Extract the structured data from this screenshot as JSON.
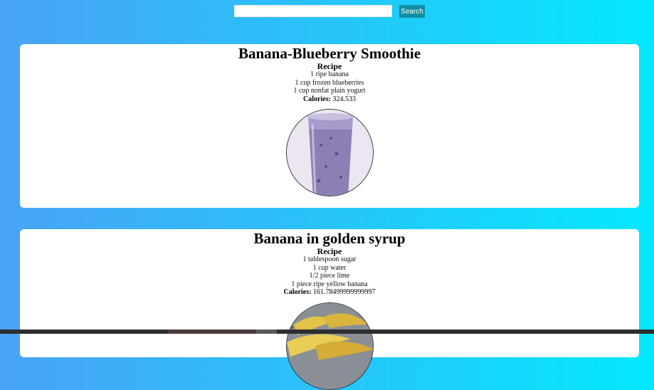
{
  "search": {
    "placeholder": "",
    "value": "",
    "button_label": "Search"
  },
  "recipes": [
    {
      "title": "Banana-Blueberry Smoothie",
      "recipe_label": "Recipe",
      "ingredients": [
        "1 ripe banana",
        "1 cup frozen blueberries",
        "1 cup nonfat plain yogurt"
      ],
      "calories_label": "Calories:",
      "calories_value": "324.533",
      "image": "blueberry-smoothie-glass"
    },
    {
      "title": "Banana in golden syrup",
      "recipe_label": "Recipe",
      "ingredients": [
        "1 tablespoon sugar",
        "1 cup water",
        "1/2 piece lime",
        "1 piece ripe yellow banana"
      ],
      "calories_label": "Calories:",
      "calories_value": "161.78499999999997",
      "image": "bananas-bowl"
    }
  ],
  "colors": {
    "background_start": "#4aa3f6",
    "background_end": "#04e9fd",
    "search_button": "#0f8ea2",
    "card": "#ffffff"
  }
}
